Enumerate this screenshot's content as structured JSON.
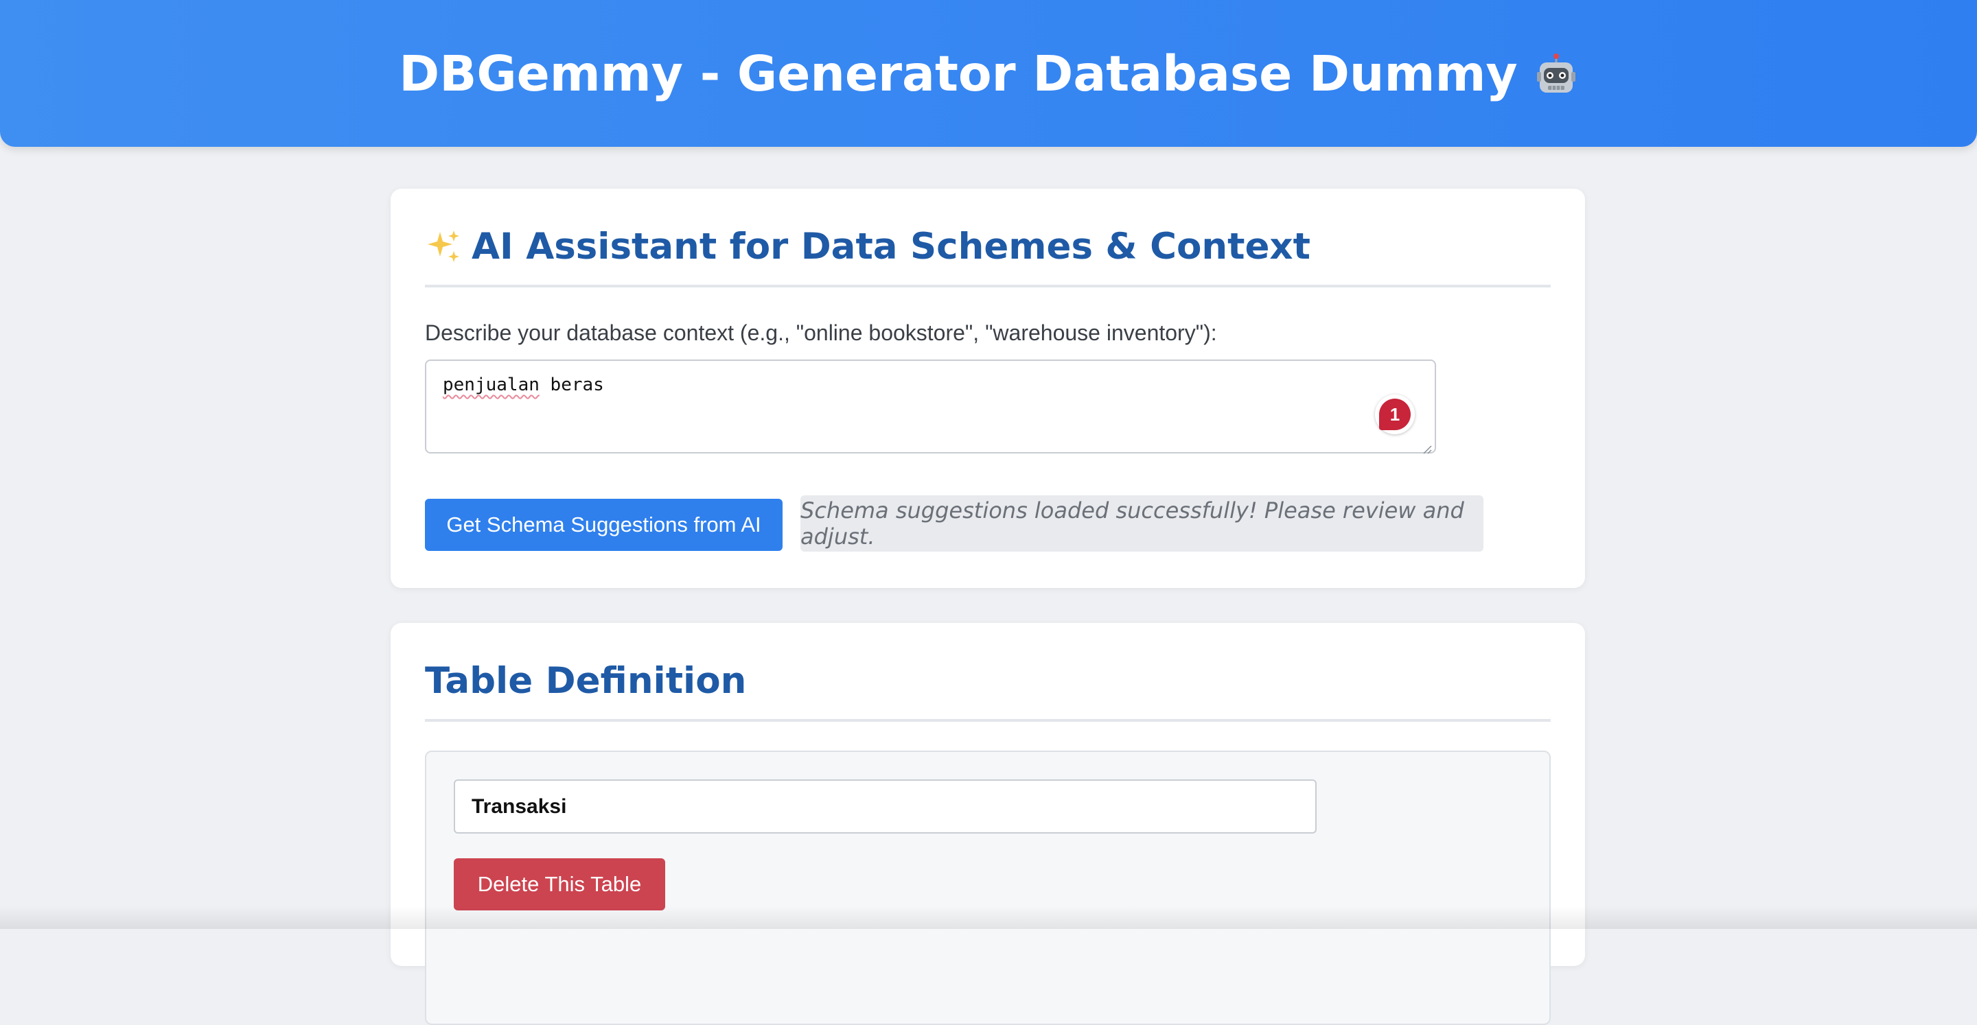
{
  "header": {
    "title": "DBGemmy - Generator Database Dummy",
    "icon": "robot-icon"
  },
  "ai_assistant": {
    "icon": "sparkles-icon",
    "title": "AI Assistant for Data Schemes & Context",
    "prompt_label": "Describe your database context (e.g., \"online bookstore\", \"warehouse inventory\"):",
    "context_value_word1": "penjualan",
    "context_value_word2": " beras",
    "grammar_badge_count": "1",
    "suggest_button_label": "Get Schema Suggestions from AI",
    "status_message": "Schema suggestions loaded successfully! Please review and adjust."
  },
  "table_definition": {
    "title": "Table Definition",
    "tables": [
      {
        "name": "Transaksi",
        "delete_button_label": "Delete This Table"
      }
    ]
  },
  "colors": {
    "header_bg": "#3a88f2",
    "primary_button": "#2f80ed",
    "danger_button": "#cc4450",
    "section_title": "#1f5aa6"
  }
}
